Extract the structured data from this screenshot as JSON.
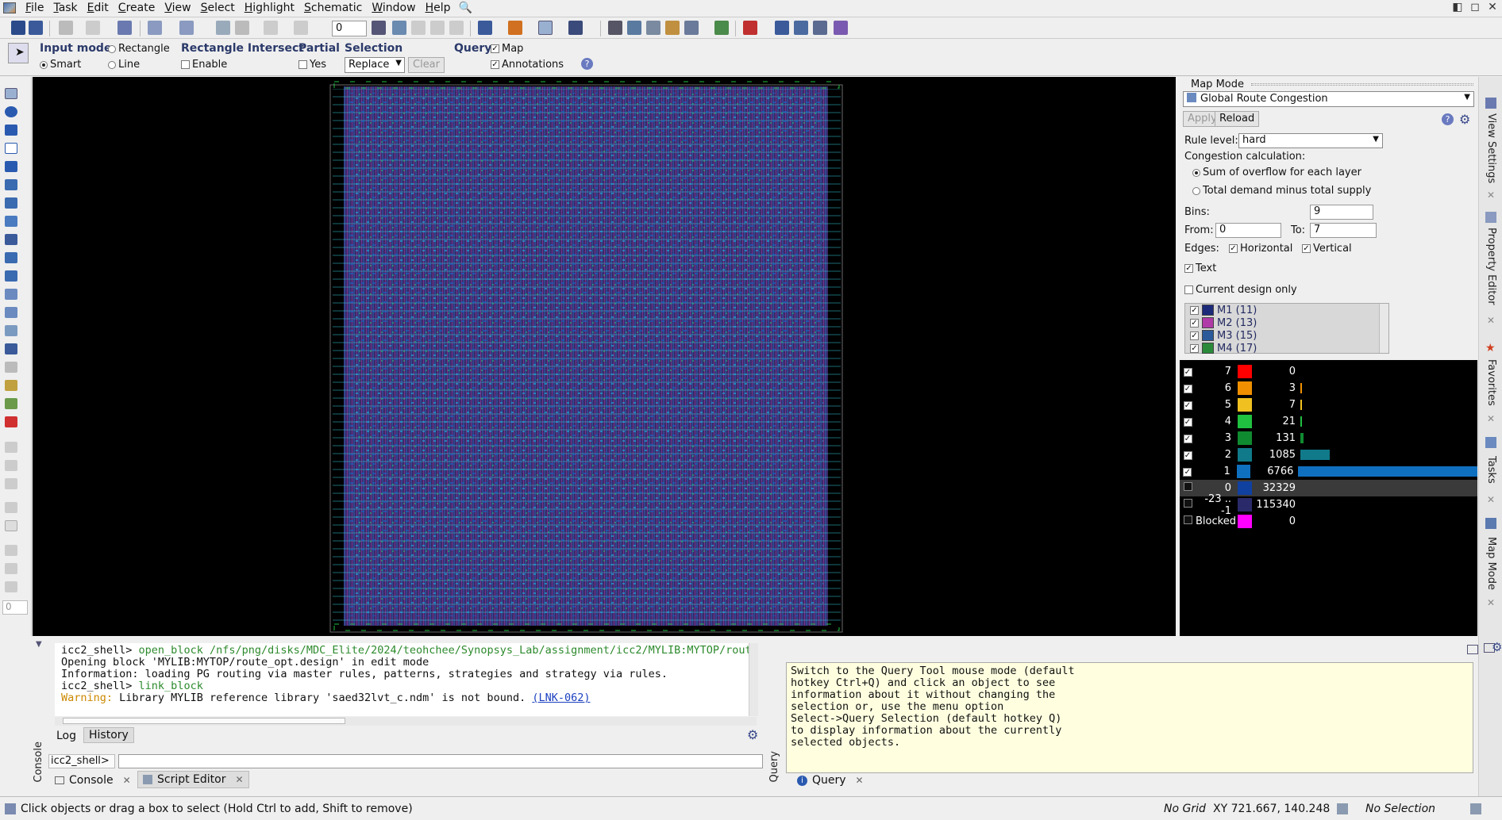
{
  "menu": [
    "File",
    "Task",
    "Edit",
    "Create",
    "View",
    "Select",
    "Highlight",
    "Schematic",
    "Window",
    "Help"
  ],
  "toolbar": {
    "zoom_field": "0"
  },
  "select_bar": {
    "input_mode_title": "Input mode",
    "input_mode_options": [
      "Smart",
      "Rectangle",
      "Line"
    ],
    "rect_intersect_title": "Rectangle Intersect",
    "rect_intersect_enable": "Enable",
    "partial_title": "Partial",
    "partial_yes": "Yes",
    "selection_title": "Selection",
    "selection_value": "Replace",
    "clear_label": "Clear",
    "query_title": "Query",
    "query_map": "Map",
    "query_annotations": "Annotations"
  },
  "left_toolbar": {
    "field": "0"
  },
  "map_mode": {
    "title": "Map Mode",
    "map_select": "Global Route Congestion",
    "apply": "Apply",
    "reload": "Reload",
    "rule_level_label": "Rule level:",
    "rule_level_value": "hard",
    "congestion_calc_label": "Congestion calculation:",
    "calc_opt1": "Sum of overflow for each layer",
    "calc_opt2": "Total demand minus total supply",
    "bins_label": "Bins:",
    "bins_value": "9",
    "from_label": "From:",
    "from_value": "0",
    "to_label": "To:",
    "to_value": "7",
    "edges_label": "Edges:",
    "edges_h": "Horizontal",
    "edges_v": "Vertical",
    "text_label": "Text",
    "current_design_only": "Current design only",
    "layers": [
      {
        "name": "M1 (11)",
        "color": "#1c2a7a"
      },
      {
        "name": "M2 (13)",
        "color": "#b03aa8"
      },
      {
        "name": "M3 (15)",
        "color": "#2a5a9a"
      },
      {
        "name": "M4 (17)",
        "color": "#2a8a3a"
      }
    ],
    "legend": [
      {
        "key": "7",
        "color": "#ff0000",
        "count": "0",
        "checked": true,
        "frac": 0
      },
      {
        "key": "6",
        "color": "#f09000",
        "count": "3",
        "checked": true,
        "frac": 0.0005
      },
      {
        "key": "5",
        "color": "#f0c020",
        "count": "7",
        "checked": true,
        "frac": 0.001
      },
      {
        "key": "4",
        "color": "#20c040",
        "count": "21",
        "checked": true,
        "frac": 0.003
      },
      {
        "key": "3",
        "color": "#108a30",
        "count": "131",
        "checked": true,
        "frac": 0.019
      },
      {
        "key": "2",
        "color": "#107a8a",
        "count": "1085",
        "checked": true,
        "frac": 0.16
      },
      {
        "key": "1",
        "color": "#1070c0",
        "count": "6766",
        "checked": true,
        "frac": 1.0
      },
      {
        "key": "0",
        "color": "#1040a0",
        "count": "32329",
        "checked": false,
        "frac": 0
      },
      {
        "key": "-23 .. -1",
        "color": "#2a2a6a",
        "count": "115340",
        "checked": false,
        "frac": 0
      },
      {
        "key": "Blocked",
        "color": "#ff00ff",
        "count": "0",
        "checked": false,
        "frac": 0
      }
    ]
  },
  "side_tabs": [
    "View Settings",
    "Property Editor",
    "Favorites",
    "Tasks",
    "Map Mode"
  ],
  "console": {
    "side_label": "Console",
    "prompt1": "icc2_shell> ",
    "cmd1": "open_block /nfs/png/disks/MDC_Elite/2024/teohchee/Synopsys_Lab/assignment/icc2/MYLIB:MYTOP/route",
    "line2": "Opening block 'MYLIB:MYTOP/route_opt.design' in edit mode",
    "line3": "Information: loading PG routing via master rules, patterns, strategies and strategy via rules.",
    "prompt2": "icc2_shell> ",
    "cmd2": "link_block",
    "warn_prefix": "Warning:",
    "warn_text": " Library MYLIB reference library 'saed32lvt_c.ndm' is not bound. ",
    "warn_link": "(LNK-062)",
    "tab_log": "Log",
    "tab_history": "History",
    "input_prompt": "icc2_shell>",
    "tab_console": "Console",
    "tab_script": "Script Editor"
  },
  "query": {
    "side_label": "Query",
    "text": "Switch to the Query Tool mouse mode (default\nhotkey Ctrl+Q) and click an object to see\ninformation about it without changing the\nselection or, use the menu option\nSelect->Query Selection (default hotkey Q)\nto display information about the currently\nselected objects.",
    "tab": "Query"
  },
  "status": {
    "hint": "Click objects or drag a box to select (Hold Ctrl to add, Shift to remove)",
    "grid": "No Grid",
    "xy": "XY 721.667, 140.248",
    "selection": "No Selection"
  }
}
